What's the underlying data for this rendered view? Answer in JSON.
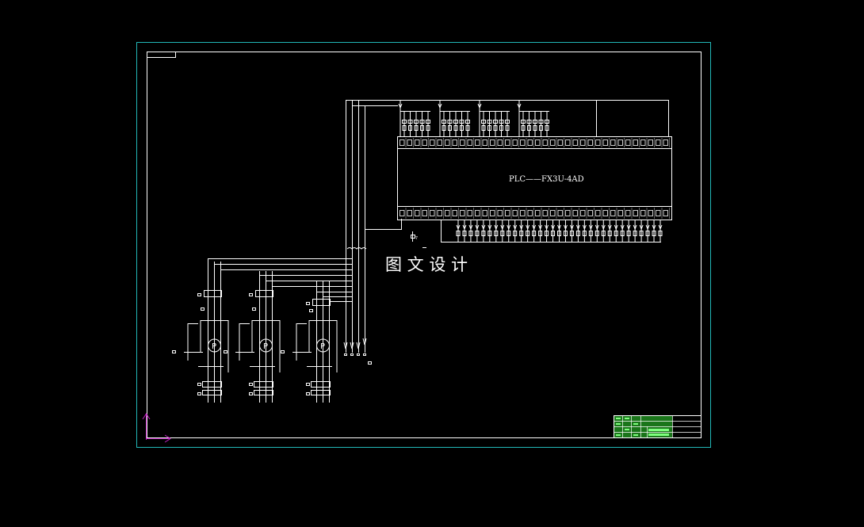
{
  "drawing": {
    "plc_label": "PLC——FX3U-4AD",
    "watermark": "图 文 设 计",
    "motor_symbol": "P",
    "input_terminal_count": 36,
    "output_terminal_count": 36,
    "pump_count": 3
  },
  "colors": {
    "background": "#000000",
    "sheet_border": "#22b8b8",
    "lines": "#ffffff",
    "axis": "#c020c0",
    "title_block_fill": "#2ea52e"
  },
  "icons": {
    "motor": "pump-motor-icon",
    "ucs": "ucs-axis-icon"
  }
}
